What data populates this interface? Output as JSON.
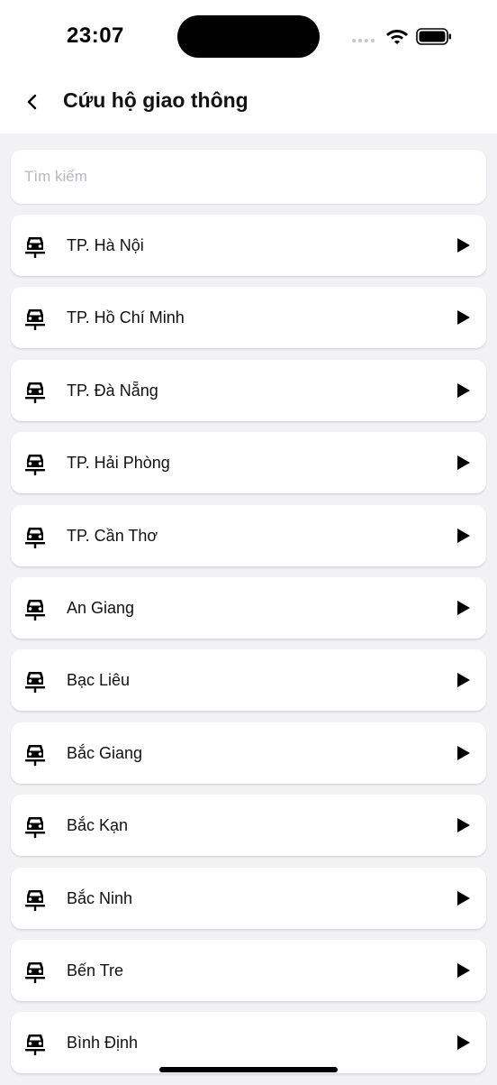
{
  "status_bar": {
    "time": "23:07"
  },
  "header": {
    "title": "Cứu hộ giao thông"
  },
  "search": {
    "placeholder": "Tìm kiếm",
    "value": ""
  },
  "items": [
    {
      "label": "TP. Hà Nội",
      "icon": "car-rescue-icon"
    },
    {
      "label": "TP. Hồ Chí Minh",
      "icon": "car-rescue-icon"
    },
    {
      "label": "TP. Đà Nẵng",
      "icon": "car-rescue-icon"
    },
    {
      "label": "TP. Hải Phòng",
      "icon": "car-rescue-icon"
    },
    {
      "label": "TP. Cần Thơ",
      "icon": "car-rescue-icon"
    },
    {
      "label": "An Giang",
      "icon": "car-rescue-icon"
    },
    {
      "label": "Bạc Liêu",
      "icon": "car-rescue-icon"
    },
    {
      "label": "Bắc Giang",
      "icon": "car-rescue-icon"
    },
    {
      "label": "Bắc Kạn",
      "icon": "car-rescue-icon"
    },
    {
      "label": "Bắc Ninh",
      "icon": "car-rescue-icon"
    },
    {
      "label": "Bến Tre",
      "icon": "car-rescue-icon"
    },
    {
      "label": "Bình Định",
      "icon": "car-rescue-icon"
    }
  ],
  "colors": {
    "background": "#f2f2f4",
    "card": "#ffffff",
    "text": "#111111",
    "placeholder": "#b8b8be"
  }
}
